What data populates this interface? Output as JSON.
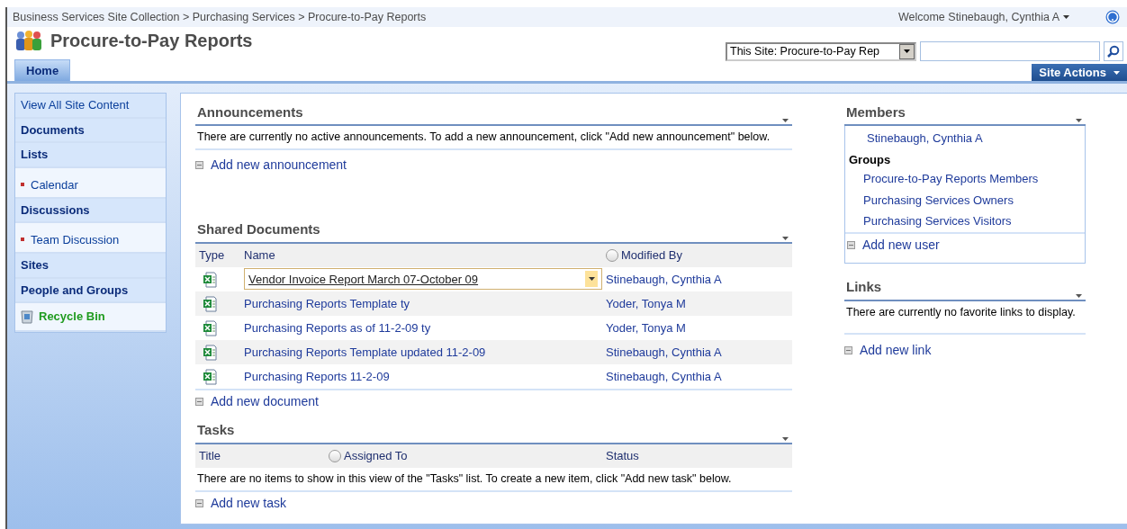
{
  "breadcrumb": "Business Services Site Collection > Purchasing Services > Procure-to-Pay Reports",
  "welcome": "Welcome Stinebaugh, Cynthia A",
  "site_title": "Procure-to-Pay Reports",
  "search": {
    "scope": "This Site: Procure-to-Pay Rep"
  },
  "tabs": [
    {
      "label": "Home",
      "selected": true
    }
  ],
  "site_actions": "Site Actions",
  "nav": [
    {
      "label": "View All Site Content",
      "kind": "link"
    },
    {
      "label": "Documents",
      "kind": "heading"
    },
    {
      "label": "Lists",
      "kind": "heading"
    },
    {
      "label": "Calendar",
      "kind": "item"
    },
    {
      "label": "Discussions",
      "kind": "heading"
    },
    {
      "label": "Team Discussion",
      "kind": "item"
    },
    {
      "label": "Sites",
      "kind": "heading"
    },
    {
      "label": "People and Groups",
      "kind": "heading"
    },
    {
      "label": "Recycle Bin",
      "kind": "recycle"
    }
  ],
  "announcements": {
    "title": "Announcements",
    "message": "There are currently no active announcements. To add a new announcement, click \"Add new announcement\" below.",
    "add_link": "Add new announcement"
  },
  "shared_documents": {
    "title": "Shared Documents",
    "columns": [
      "Type",
      "Name",
      "Modified By"
    ],
    "rows": [
      {
        "name": "Vendor Invoice Report March 07-October 09",
        "modified_by": "Stinebaugh, Cynthia A",
        "selected": true
      },
      {
        "name": "Purchasing Reports Template ty",
        "modified_by": "Yoder, Tonya M",
        "selected": false
      },
      {
        "name": "Purchasing Reports as of 11-2-09 ty",
        "modified_by": "Yoder, Tonya M",
        "selected": false
      },
      {
        "name": "Purchasing Reports Template updated 11-2-09",
        "modified_by": "Stinebaugh, Cynthia A",
        "selected": false
      },
      {
        "name": "Purchasing Reports 11-2-09",
        "modified_by": "Stinebaugh, Cynthia A",
        "selected": false
      }
    ],
    "add_link": "Add new document"
  },
  "tasks": {
    "title": "Tasks",
    "columns": [
      "Title",
      "Assigned To",
      "Status"
    ],
    "message": "There are no items to show in this view of the \"Tasks\" list. To create a new item, click \"Add new task\" below.",
    "add_link": "Add new task"
  },
  "members": {
    "title": "Members",
    "member": "Stinebaugh, Cynthia A",
    "groups_label": "Groups",
    "groups": [
      "Procure-to-Pay Reports Members",
      "Purchasing Services Owners",
      "Purchasing Services Visitors"
    ],
    "add_link": "Add new user"
  },
  "links": {
    "title": "Links",
    "message": "There are currently no favorite links to display.",
    "add_link": "Add new link"
  }
}
